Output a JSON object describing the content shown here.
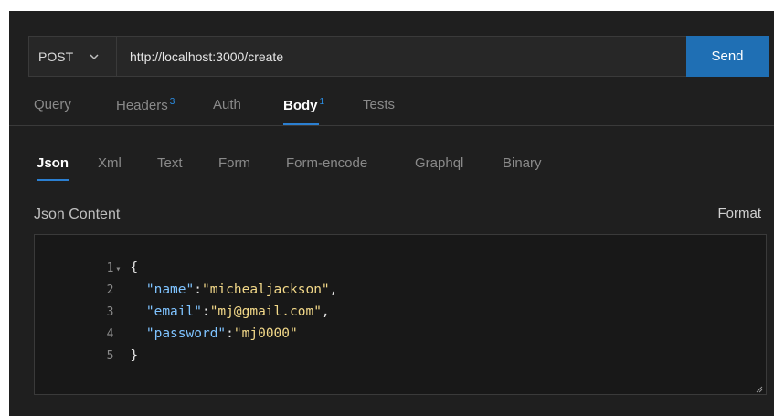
{
  "request": {
    "method": "POST",
    "url": "http://localhost:3000/create",
    "send_label": "Send"
  },
  "tabs": [
    {
      "label": "Query",
      "count": ""
    },
    {
      "label": "Headers",
      "count": "3"
    },
    {
      "label": "Auth",
      "count": ""
    },
    {
      "label": "Body",
      "count": "1"
    },
    {
      "label": "Tests",
      "count": ""
    }
  ],
  "active_tab": "Body",
  "body_tabs": [
    "Json",
    "Xml",
    "Text",
    "Form",
    "Form-encode",
    "Graphql",
    "Binary"
  ],
  "active_body_tab": "Json",
  "json_section": {
    "label": "Json Content",
    "format_label": "Format"
  },
  "editor": {
    "lines": [
      {
        "num": "1",
        "text": "{"
      },
      {
        "num": "2",
        "key": "\"name\"",
        "value": "\"michealjackson\"",
        "suffix": ","
      },
      {
        "num": "3",
        "key": "\"email\"",
        "value": "\"mj@gmail.com\"",
        "suffix": ","
      },
      {
        "num": "4",
        "key": "\"password\"",
        "value": "\"mj0000\"",
        "suffix": ""
      },
      {
        "num": "5",
        "text": "}"
      }
    ]
  },
  "colors": {
    "accent": "#1f6fb4",
    "badge": "#2b8fe6",
    "json_key": "#7fc3ff",
    "json_string": "#f3d989",
    "background": "#1f1f1f"
  },
  "icons": [
    "chevron-down-icon",
    "fold-arrow-icon",
    "resize-grip-icon"
  ]
}
